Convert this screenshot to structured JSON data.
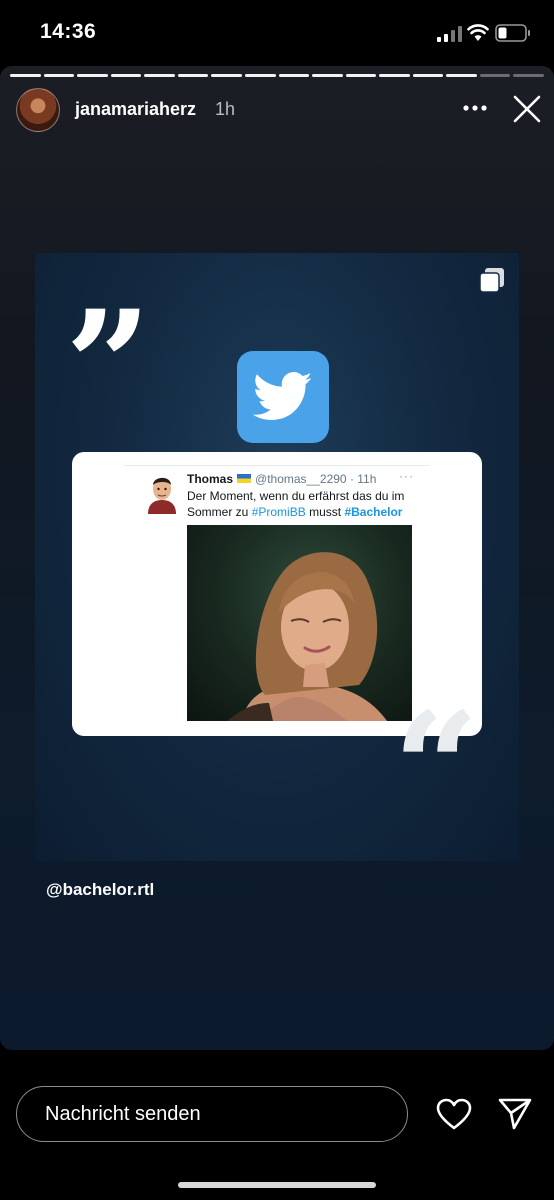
{
  "status_bar": {
    "time": "14:36"
  },
  "story": {
    "progress": {
      "segments_total": 16,
      "segments_viewed": 14
    },
    "username": "janamariaherz",
    "timestamp": "1h",
    "mention": "@bachelor.rtl"
  },
  "post": {
    "quote_open": "”",
    "quote_close": "“",
    "tweet": {
      "name": "Thomas",
      "handle": "@thomas__2290",
      "time": "· 11h",
      "text_line1": "Der Moment, wenn du erfährst das du im",
      "text_line2_prefix": "Sommer zu",
      "hashtag1": "#PromiBB",
      "text_middle": "musst",
      "hashtag2": "#Bachelor",
      "dots": "···"
    }
  },
  "bottom": {
    "message_placeholder": "Nachricht senden"
  },
  "icons": {
    "more": "more-horizontal-icon",
    "close": "close-icon",
    "heart": "heart-icon",
    "send": "send-icon",
    "twitter": "twitter-bird-icon",
    "multi": "multiple-images-icon"
  },
  "colors": {
    "twitter_blue": "#4aa3e8",
    "hashtag": "#1b95e0"
  }
}
